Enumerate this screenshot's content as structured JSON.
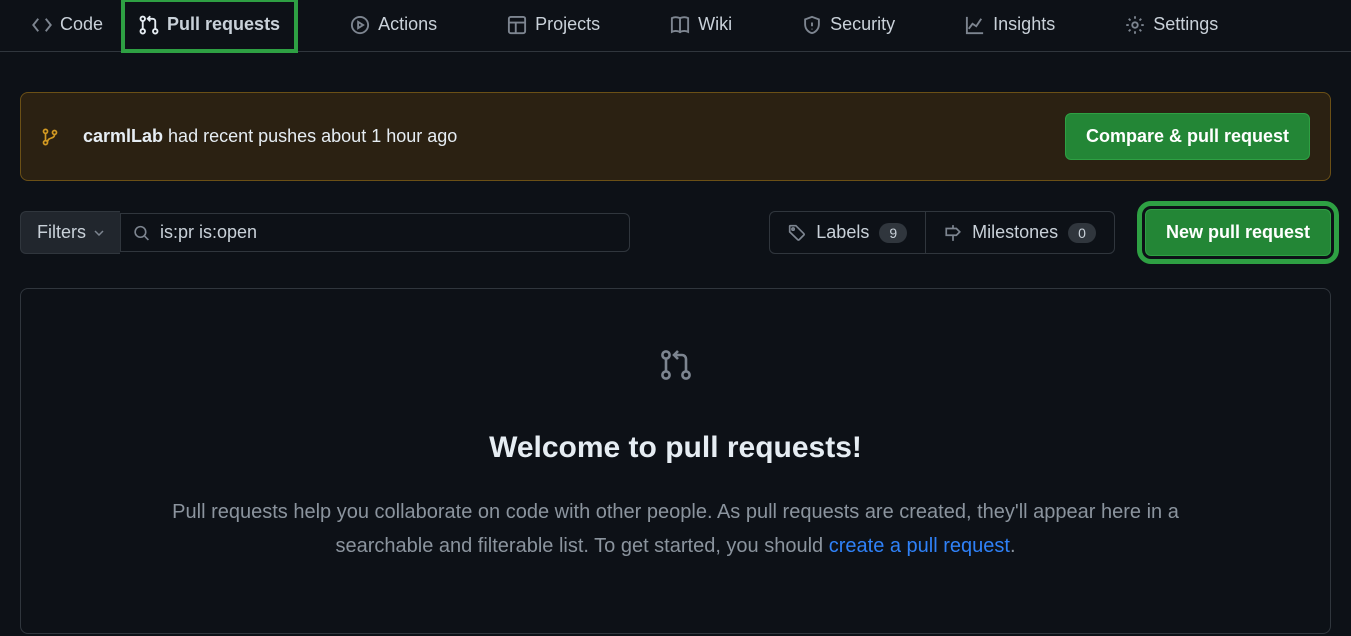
{
  "nav": {
    "code": "Code",
    "pulls": "Pull requests",
    "actions": "Actions",
    "projects": "Projects",
    "wiki": "Wiki",
    "security": "Security",
    "insights": "Insights",
    "settings": "Settings"
  },
  "alert": {
    "branch": "carmlLab",
    "text": " had recent pushes about 1 hour ago",
    "button": "Compare & pull request"
  },
  "toolbar": {
    "filters": "Filters",
    "search_value": "is:pr is:open",
    "labels": "Labels",
    "labels_count": "9",
    "milestones": "Milestones",
    "milestones_count": "0",
    "new_pr": "New pull request"
  },
  "empty": {
    "title": "Welcome to pull requests!",
    "desc_before": "Pull requests help you collaborate on code with other people. As pull requests are created, they'll appear here in a searchable and filterable list. To get started, you should ",
    "link": "create a pull request",
    "desc_after": "."
  }
}
